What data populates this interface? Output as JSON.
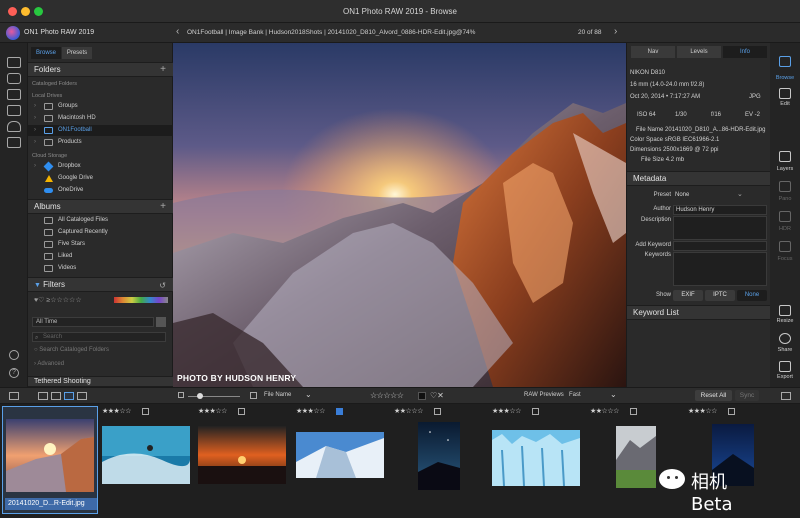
{
  "window": {
    "title": "ON1 Photo RAW 2019 - Browse",
    "traffic_colors": [
      "#fe5f57",
      "#febc2e",
      "#28c840"
    ]
  },
  "toolbar": {
    "app_name": "ON1 Photo RAW 2019",
    "breadcrumb": "ON1Football | Image Bank | Hudson2018Shots | 20141020_D810_Alvord_0886-HDR-Edit.jpg@74%",
    "page_count": "20 of 88"
  },
  "left_panel": {
    "tabs": [
      "Browse",
      "Presets"
    ],
    "folders": {
      "title": "Folders",
      "cataloged_label": "Cataloged Folders",
      "local_label": "Local Drives",
      "items": [
        "Groups",
        "Macintosh HD",
        "ON1Football",
        "Products"
      ],
      "selected_index": 2,
      "cloud_label": "Cloud Storage",
      "cloud_items": [
        "Dropbox",
        "Google Drive",
        "OneDrive"
      ]
    },
    "albums": {
      "title": "Albums",
      "items": [
        "All Cataloged Files",
        "Captured Recently",
        "Five Stars",
        "Liked",
        "Videos"
      ]
    },
    "filters": {
      "title": "Filters",
      "time": "All Time",
      "search_placeholder": "Search",
      "search_cataloged": "Search Cataloged Folders",
      "advanced": "Advanced",
      "next_section": "Tethered Shooting"
    }
  },
  "viewer": {
    "photo_credit": "PHOTO BY HUDSON HENRY"
  },
  "right_panel": {
    "tabs": [
      "Nav",
      "Levels",
      "Info"
    ],
    "active_tab": 2,
    "camera": {
      "model": "NIKON D810",
      "lens": "16 mm (14.0-24.0 mm f/2.8)",
      "date": "Oct 20, 2014 • 7:17:27 AM",
      "format": "JPG",
      "iso": "ISO 64",
      "shutter": "1/30",
      "aperture": "f/16",
      "ev": "EV -2"
    },
    "file": {
      "name_label": "File Name",
      "name": "20141020_D810_A...86-HDR-Edit.jpg",
      "colorspace_label": "Color Space",
      "colorspace": "sRGB IEC61966-2.1",
      "dimensions_label": "Dimensions",
      "dimensions": "2500x1669 @ 72 ppi",
      "size_label": "File Size",
      "size": "4.2 mb"
    },
    "metadata": {
      "title": "Metadata",
      "preset_label": "Preset",
      "preset": "None",
      "author_label": "Author",
      "author": "Hudson Henry",
      "description_label": "Description",
      "add_keyword_label": "Add Keyword",
      "keywords_label": "Keywords",
      "show_label": "Show",
      "show_options": [
        "EXIF",
        "IPTC",
        "None"
      ]
    },
    "keyword_list": "Keyword List"
  },
  "right_rail": {
    "items": [
      "Browse",
      "Edit",
      "Layers",
      "Pano",
      "HDR",
      "Focus",
      "Resize",
      "Share",
      "Export"
    ]
  },
  "bottom_bar": {
    "sort_label": "File Name",
    "raw_previews_label": "RAW Previews",
    "raw_previews_value": "Fast",
    "reset_all": "Reset All",
    "sync": "Sync"
  },
  "filmstrip": {
    "selected_label": "20141020_D...R-Edit.jpg",
    "ratings": [
      3,
      3,
      3,
      2,
      3,
      2,
      3,
      2
    ],
    "rating_text": [
      "★★★☆☆",
      "★★★☆☆",
      "★★★☆☆",
      "★★☆☆☆",
      "★★★☆☆",
      "★★☆☆☆",
      "★★★☆☆",
      "★★☆☆☆"
    ]
  },
  "watermark": {
    "text": "相机Beta"
  }
}
